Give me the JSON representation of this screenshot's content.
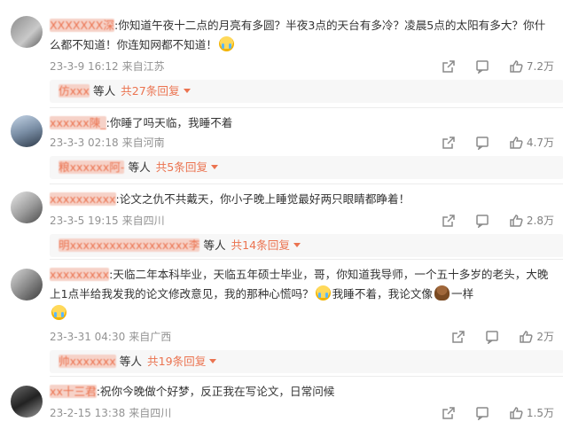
{
  "colors": {
    "accent": "#eb7350",
    "meta": "#939393",
    "reply_bg": "#f7f7f7"
  },
  "comments": [
    {
      "name": "XXXXXXX深",
      "text_before": ":你知道午夜十二点的月亮有多圆？半夜3点的天台有多冷？凌晨5点的太阳有多大？你什么都不知道！你连知网都不知道！",
      "emoji_after": "cry",
      "text_after": "",
      "date": "23-3-9 16:12",
      "location": "来自江苏",
      "likes": "7.2万",
      "reply_name": "仿xxx",
      "reply_suffix": "等人",
      "reply_more": "共27条回复"
    },
    {
      "name": "xxxxxx陳_",
      "text_before": ":你睡了吗天临，我睡不着",
      "emoji_after": "",
      "text_after": "",
      "date": "23-3-3 02:18",
      "location": "来自河南",
      "likes": "4.7万",
      "reply_name": "粮xxxxxx阿-",
      "reply_suffix": "等人",
      "reply_more": "共5条回复"
    },
    {
      "name": "xxxxxxxxxx",
      "text_before": ":论文之仇不共戴天，你小子晚上睡觉最好两只眼睛都睁着！",
      "emoji_after": "",
      "text_after": "",
      "date": "23-3-5 19:15",
      "location": "来自四川",
      "likes": "2.8万",
      "reply_name": "明xxxxxxxxxxxxxxxxxx李",
      "reply_suffix": "等人",
      "reply_more": "共14条回复"
    },
    {
      "name": "xxxxxxxxx",
      "text_before": ":天临二年本科毕业，天临五年硕士毕业，哥，你知道我导师，一个五十多岁的老头，大晚上1点半给我发我的论文修改意见，我的那种心慌吗？",
      "emoji_after": "cry",
      "text_after": "我睡不着，我论文像",
      "emoji_after2": "poop",
      "text_after2": "一样",
      "emoji_line3": "cry",
      "date": "23-3-31 04:30",
      "location": "来自广西",
      "likes": "2万",
      "reply_name": "帅xxxxxxx",
      "reply_suffix": "等人",
      "reply_more": "共19条回复"
    },
    {
      "name": "xx十三君",
      "text_before": ":祝你今晚做个好梦，反正我在写论文，日常问候",
      "emoji_after": "",
      "text_after": "",
      "date": "23-2-15 13:38",
      "location": "来自四川",
      "likes": "1.5万"
    }
  ],
  "icons": {
    "share": "share-icon",
    "comment": "comment-icon",
    "like": "thumbs-up-icon"
  }
}
